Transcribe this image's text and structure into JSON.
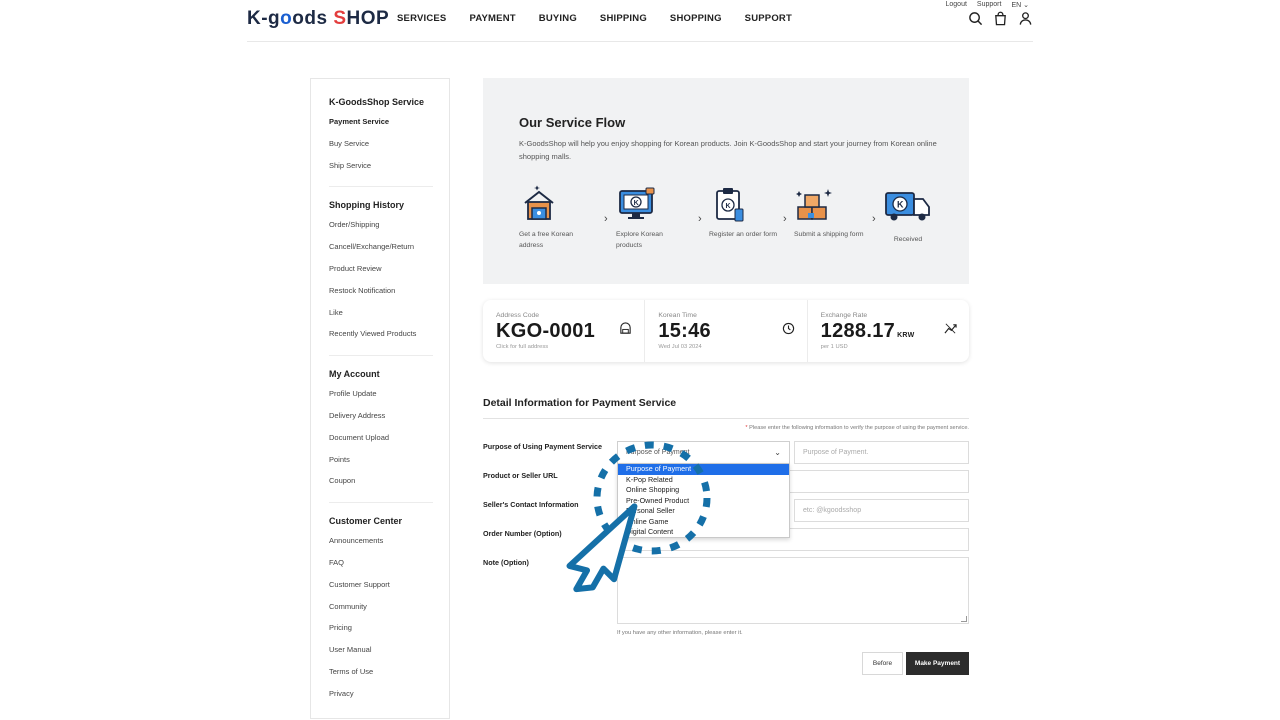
{
  "header": {
    "logo_prefix": "K-g",
    "logo_o": "o",
    "logo_mid": "ods ",
    "logo_s": "S",
    "logo_suffix": "HOP",
    "nav": [
      "SERVICES",
      "PAYMENT",
      "BUYING",
      "SHIPPING",
      "SHOPPING",
      "SUPPORT"
    ],
    "util_logout": "Logout",
    "util_support": "Support",
    "util_lang": "EN ⌄",
    "icons": [
      "search-icon",
      "cart-icon",
      "user-icon"
    ]
  },
  "sidebar": {
    "groups": [
      {
        "title": "K-GoodsShop Service",
        "items": [
          "Payment Service",
          "Buy Service",
          "Ship Service"
        ]
      },
      {
        "title": "Shopping History",
        "items": [
          "Order/Shipping",
          "Cancell/Exchange/Return",
          "Product Review",
          "Restock Notification",
          "Like",
          "Recently Viewed Products"
        ]
      },
      {
        "title": "My Account",
        "items": [
          "Profile Update",
          "Delivery Address",
          "Document Upload",
          "Points",
          "Coupon"
        ]
      },
      {
        "title": "Customer Center",
        "items": [
          "Announcements",
          "FAQ",
          "Customer Support",
          "Community",
          "Pricing",
          "User Manual",
          "Terms of Use",
          "Privacy"
        ]
      }
    ]
  },
  "flow": {
    "title": "Our Service Flow",
    "description": "K-GoodsShop will help you enjoy shopping for Korean products. Join K-GoodsShop and start your journey from Korean online shopping malls.",
    "steps": [
      {
        "label": "Get a free Korean address",
        "icon": "house-icon"
      },
      {
        "label": "Explore Korean products",
        "icon": "monitor-icon"
      },
      {
        "label": "Register an order form",
        "icon": "clipboard-icon"
      },
      {
        "label": "Submit a shipping form",
        "icon": "boxes-icon"
      },
      {
        "label": "Received",
        "icon": "truck-icon"
      }
    ],
    "arrow": "›"
  },
  "cards": {
    "address": {
      "label": "Address Code",
      "value": "KGO-0001",
      "sub": "Click for full address",
      "icon": "mailbox-icon"
    },
    "time": {
      "label": "Korean Time",
      "value": "15:46",
      "sub": "Wed Jul 03 2024",
      "icon": "clock-icon"
    },
    "rate": {
      "label": "Exchange Rate",
      "value": "1288.17",
      "unit": "KRW",
      "sub": "per 1 USD",
      "icon": "trend-icon"
    }
  },
  "form": {
    "title": "Detail Information for Payment Service",
    "note_star": "* ",
    "note": "Please enter the following information to verify the purpose of using the payment service.",
    "labels": {
      "purpose": "Purpose of Using Payment Service",
      "url": "Product or Seller URL",
      "contact": "Seller's Contact Information",
      "order": "Order Number (Option)",
      "note": "Note (Option)"
    },
    "purpose_select_value": "Purpose of Payment",
    "purpose_placeholder": "Purpose of Payment.",
    "contact_placeholder": "etc: @kgoodsshop",
    "dropdown_options": [
      "Purpose of Payment",
      "K-Pop Related",
      "Online Shopping",
      "Pre-Owned Product",
      "Personal Seller",
      "Online Game",
      "Digital Content"
    ],
    "hint": "If you have any other information, please enter it.",
    "btn_before": "Before",
    "btn_pay": "Make Payment"
  },
  "colors": {
    "accent": "#1f6ee8",
    "cursor_overlay": "#1570a8",
    "dark_button": "#2c2c2c"
  }
}
